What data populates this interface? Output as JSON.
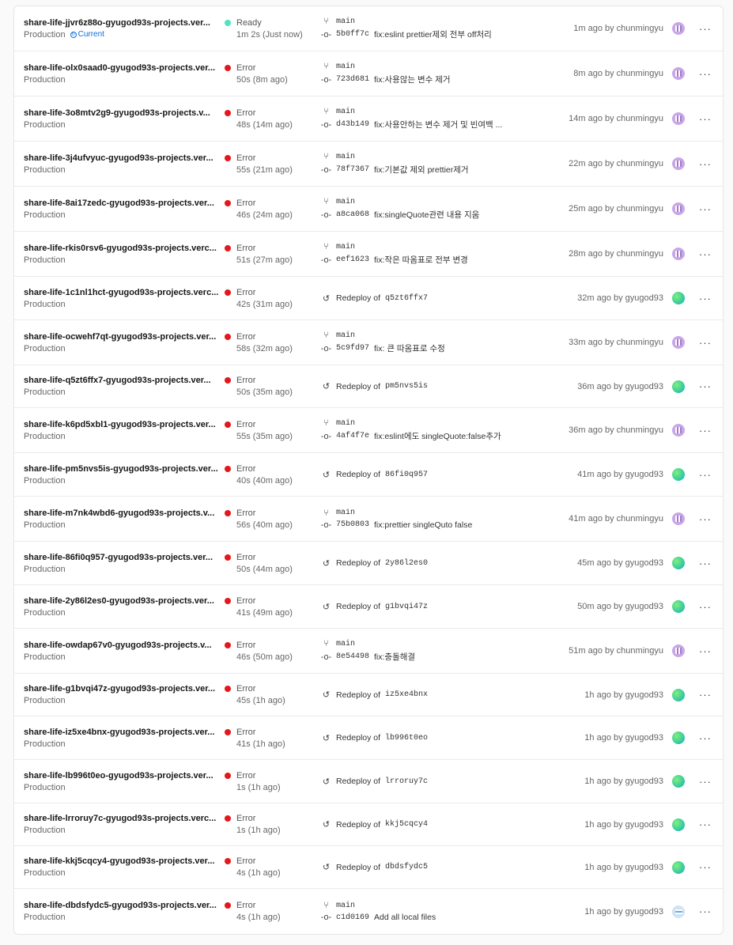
{
  "deployments": [
    {
      "name": "share-life-jjvr6z88o-gyugod93s-projects.ver...",
      "env": "Production",
      "current": "Current",
      "status": "Ready",
      "duration": "1m 2s (Just now)",
      "type": "commit",
      "branch": "main",
      "hash": "5b0ff7c",
      "message": "fix:eslint prettier제외 전부 off처리",
      "time": "1m ago by chunmingyu",
      "avatar": "user"
    },
    {
      "name": "share-life-olx0saad0-gyugod93s-projects.ver...",
      "env": "Production",
      "status": "Error",
      "duration": "50s (8m ago)",
      "type": "commit",
      "branch": "main",
      "hash": "723d681",
      "message": "fix:사용않는 변수 제거",
      "time": "8m ago by chunmingyu",
      "avatar": "user"
    },
    {
      "name": "share-life-3o8mtv2g9-gyugod93s-projects.v...",
      "env": "Production",
      "status": "Error",
      "duration": "48s (14m ago)",
      "type": "commit",
      "branch": "main",
      "hash": "d43b149",
      "message": "fix:사용안하는 변수 제거 및 빈여백 ...",
      "time": "14m ago by chunmingyu",
      "avatar": "user"
    },
    {
      "name": "share-life-3j4ufvyuc-gyugod93s-projects.ver...",
      "env": "Production",
      "status": "Error",
      "duration": "55s (21m ago)",
      "type": "commit",
      "branch": "main",
      "hash": "78f7367",
      "message": "fix:기본값 제외 prettier제거",
      "time": "22m ago by chunmingyu",
      "avatar": "user"
    },
    {
      "name": "share-life-8ai17zedc-gyugod93s-projects.ver...",
      "env": "Production",
      "status": "Error",
      "duration": "46s (24m ago)",
      "type": "commit",
      "branch": "main",
      "hash": "a8ca068",
      "message": "fix:singleQuote관련 내용 지움",
      "time": "25m ago by chunmingyu",
      "avatar": "user"
    },
    {
      "name": "share-life-rkis0rsv6-gyugod93s-projects.verc...",
      "env": "Production",
      "status": "Error",
      "duration": "51s (27m ago)",
      "type": "commit",
      "branch": "main",
      "hash": "eef1623",
      "message": "fix:작은 따옴표로 전부 변경",
      "time": "28m ago by chunmingyu",
      "avatar": "user"
    },
    {
      "name": "share-life-1c1nl1hct-gyugod93s-projects.verc...",
      "env": "Production",
      "status": "Error",
      "duration": "42s (31m ago)",
      "type": "redeploy",
      "redeploy_label": "Redeploy of",
      "ref": "q5zt6ffx7",
      "time": "32m ago by gyugod93",
      "avatar": "grad"
    },
    {
      "name": "share-life-ocwehf7qt-gyugod93s-projects.ver...",
      "env": "Production",
      "status": "Error",
      "duration": "58s (32m ago)",
      "type": "commit",
      "branch": "main",
      "hash": "5c9fd97",
      "message": "fix: 큰 따옴표로 수정",
      "time": "33m ago by chunmingyu",
      "avatar": "user"
    },
    {
      "name": "share-life-q5zt6ffx7-gyugod93s-projects.ver...",
      "env": "Production",
      "status": "Error",
      "duration": "50s (35m ago)",
      "type": "redeploy",
      "redeploy_label": "Redeploy of",
      "ref": "pm5nvs5is",
      "time": "36m ago by gyugod93",
      "avatar": "grad"
    },
    {
      "name": "share-life-k6pd5xbl1-gyugod93s-projects.ver...",
      "env": "Production",
      "status": "Error",
      "duration": "55s (35m ago)",
      "type": "commit",
      "branch": "main",
      "hash": "4af4f7e",
      "message": "fix:eslint에도 singleQuote:false추가",
      "time": "36m ago by chunmingyu",
      "avatar": "user"
    },
    {
      "name": "share-life-pm5nvs5is-gyugod93s-projects.ver...",
      "env": "Production",
      "status": "Error",
      "duration": "40s (40m ago)",
      "type": "redeploy",
      "redeploy_label": "Redeploy of",
      "ref": "86fi0q957",
      "time": "41m ago by gyugod93",
      "avatar": "grad"
    },
    {
      "name": "share-life-m7nk4wbd6-gyugod93s-projects.v...",
      "env": "Production",
      "status": "Error",
      "duration": "56s (40m ago)",
      "type": "commit",
      "branch": "main",
      "hash": "75b0803",
      "message": "fix:prettier singleQuto false",
      "time": "41m ago by chunmingyu",
      "avatar": "user"
    },
    {
      "name": "share-life-86fi0q957-gyugod93s-projects.ver...",
      "env": "Production",
      "status": "Error",
      "duration": "50s (44m ago)",
      "type": "redeploy",
      "redeploy_label": "Redeploy of",
      "ref": "2y86l2es0",
      "time": "45m ago by gyugod93",
      "avatar": "grad"
    },
    {
      "name": "share-life-2y86l2es0-gyugod93s-projects.ver...",
      "env": "Production",
      "status": "Error",
      "duration": "41s (49m ago)",
      "type": "redeploy",
      "redeploy_label": "Redeploy of",
      "ref": "g1bvqi47z",
      "time": "50m ago by gyugod93",
      "avatar": "grad"
    },
    {
      "name": "share-life-owdap67v0-gyugod93s-projects.v...",
      "env": "Production",
      "status": "Error",
      "duration": "46s (50m ago)",
      "type": "commit",
      "branch": "main",
      "hash": "8e54498",
      "message": "fix:충돌해결",
      "time": "51m ago by chunmingyu",
      "avatar": "user"
    },
    {
      "name": "share-life-g1bvqi47z-gyugod93s-projects.ver...",
      "env": "Production",
      "status": "Error",
      "duration": "45s (1h ago)",
      "type": "redeploy",
      "redeploy_label": "Redeploy of",
      "ref": "iz5xe4bnx",
      "time": "1h ago by gyugod93",
      "avatar": "grad"
    },
    {
      "name": "share-life-iz5xe4bnx-gyugod93s-projects.ver...",
      "env": "Production",
      "status": "Error",
      "duration": "41s (1h ago)",
      "type": "redeploy",
      "redeploy_label": "Redeploy of",
      "ref": "lb996t0eo",
      "time": "1h ago by gyugod93",
      "avatar": "grad"
    },
    {
      "name": "share-life-lb996t0eo-gyugod93s-projects.ver...",
      "env": "Production",
      "status": "Error",
      "duration": "1s (1h ago)",
      "type": "redeploy",
      "redeploy_label": "Redeploy of",
      "ref": "lrroruy7c",
      "time": "1h ago by gyugod93",
      "avatar": "grad"
    },
    {
      "name": "share-life-lrroruy7c-gyugod93s-projects.verc...",
      "env": "Production",
      "status": "Error",
      "duration": "1s (1h ago)",
      "type": "redeploy",
      "redeploy_label": "Redeploy of",
      "ref": "kkj5cqcy4",
      "time": "1h ago by gyugod93",
      "avatar": "grad"
    },
    {
      "name": "share-life-kkj5cqcy4-gyugod93s-projects.ver...",
      "env": "Production",
      "status": "Error",
      "duration": "4s (1h ago)",
      "type": "redeploy",
      "redeploy_label": "Redeploy of",
      "ref": "dbdsfydc5",
      "time": "1h ago by gyugod93",
      "avatar": "grad"
    },
    {
      "name": "share-life-dbdsfydc5-gyugod93s-projects.ver...",
      "env": "Production",
      "status": "Error",
      "duration": "4s (1h ago)",
      "type": "commit",
      "branch": "main",
      "hash": "c1d0169",
      "message": "Add all local files",
      "time": "1h ago by gyugod93",
      "avatar": "alt"
    }
  ],
  "more_label": "···",
  "icons": {
    "branch": "git-branch-icon",
    "commit": "git-commit-icon",
    "redeploy": "redeploy-icon",
    "more": "more-horizontal-icon"
  },
  "colors": {
    "ready": "#50e3c2",
    "error": "#e5171a",
    "current": "#0a6cd8"
  }
}
